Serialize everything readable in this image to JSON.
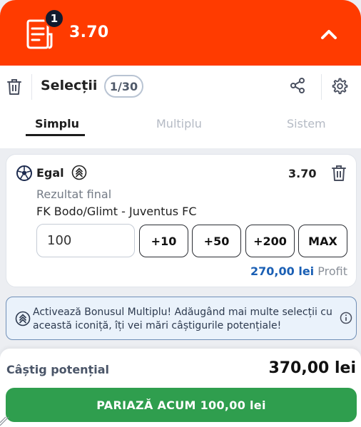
{
  "header": {
    "bet_count": "1",
    "total_odds": "3.70"
  },
  "toolbar": {
    "title": "Selecții",
    "selection_count": "1/30"
  },
  "tabs": [
    {
      "label": "Simplu",
      "active": true
    },
    {
      "label": "Multiplu",
      "active": false
    },
    {
      "label": "Sistem",
      "active": false
    }
  ],
  "bet": {
    "selection": "Egal",
    "odds": "3.70",
    "market": "Rezultat final",
    "event": "FK Bodo/Glimt - Juventus FC",
    "stake": "100",
    "quick_stakes": [
      "+10",
      "+50",
      "+200",
      "MAX"
    ],
    "win_amount": "270,00 lei",
    "win_label": "Profit"
  },
  "info": {
    "text": "Activează Bonusul Multiplu! Adăugând mai multe selecții cu această iconiță, îți vei mări câștigurile potențiale!"
  },
  "footer": {
    "potential_label": "Câștig potențial",
    "potential_value": "370,00 lei",
    "place_bet_label": "PARIAZĂ ACUM 100,00 lei"
  },
  "colors": {
    "brand": "#ff3b00",
    "cta": "#2f9e4e",
    "link": "#1a5fb4"
  },
  "icons": [
    "bet-slip-icon",
    "chevron-up-icon",
    "trash-icon",
    "share-icon",
    "gear-icon",
    "football-icon",
    "multiplier-boost-icon",
    "info-icon"
  ]
}
